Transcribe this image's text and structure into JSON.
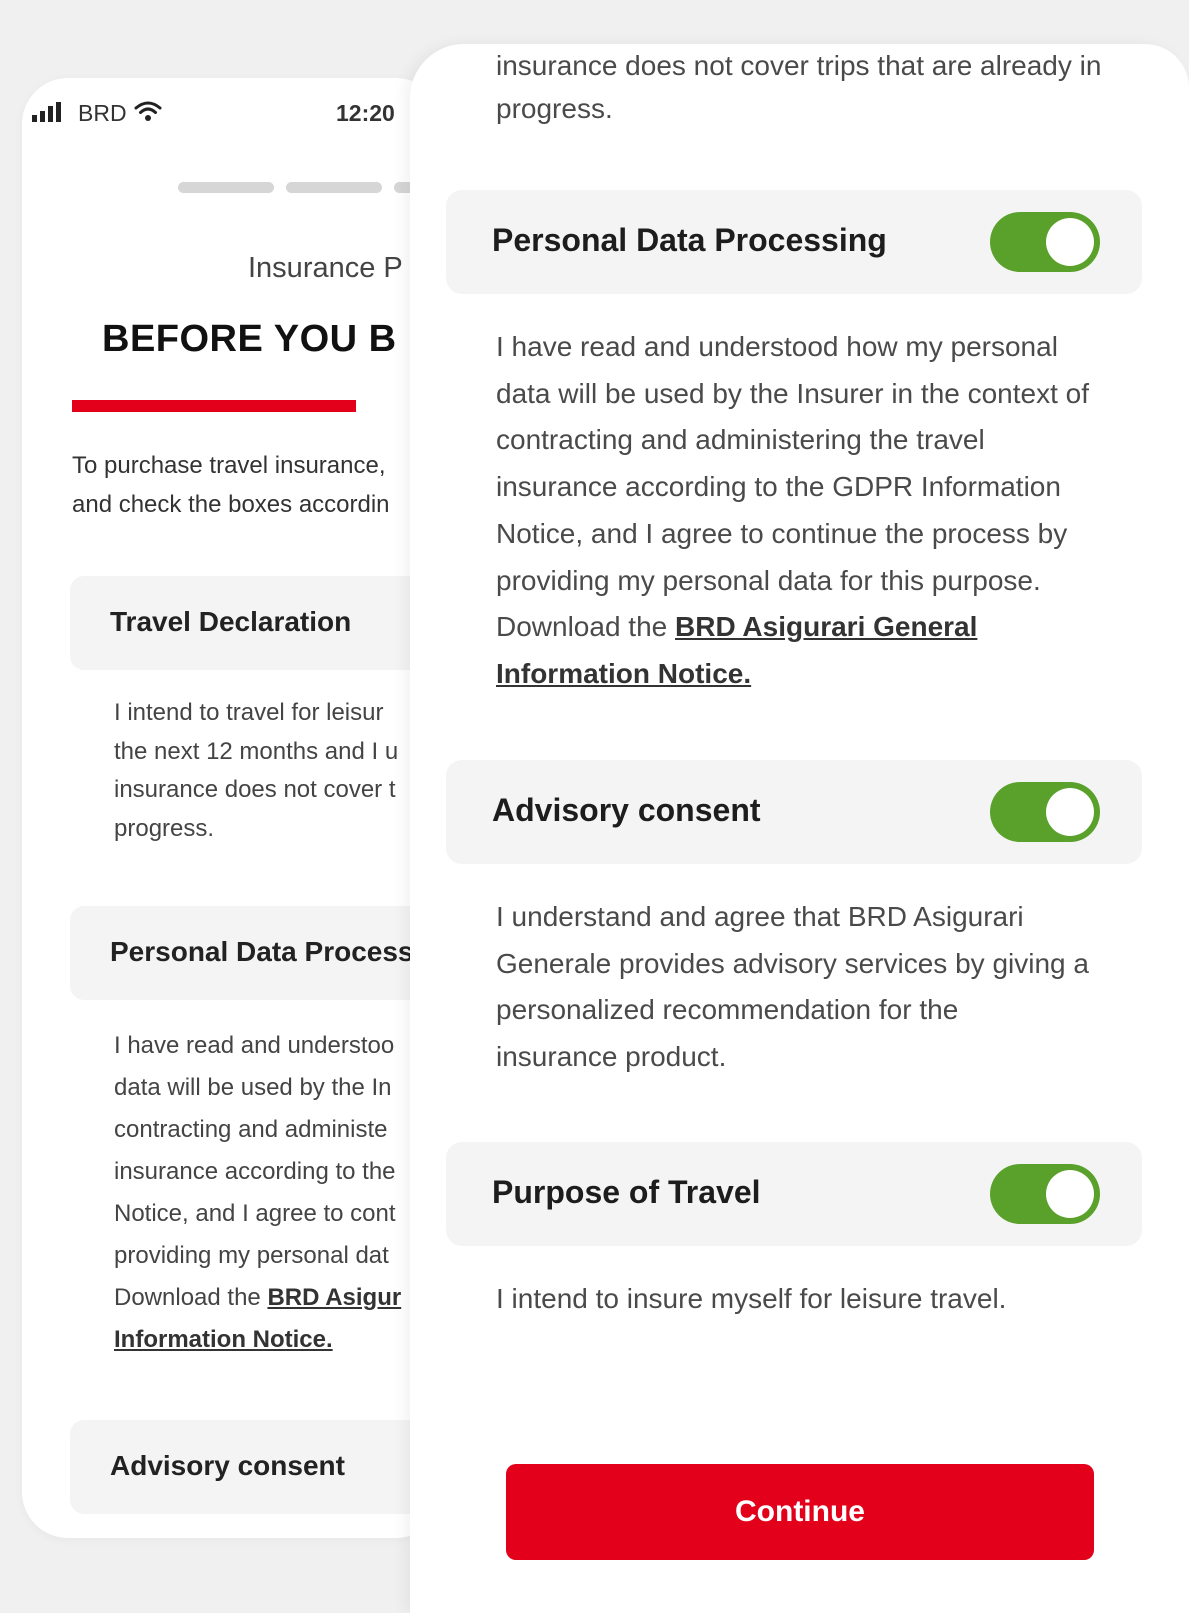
{
  "status_bar": {
    "carrier": "BRD",
    "time": "12:20",
    "icons": [
      "signal-icon",
      "wifi-icon"
    ]
  },
  "back_screen": {
    "kicker": "Insurance P",
    "title": "BEFORE YOU B",
    "intro_lines": [
      "To purchase travel insurance,",
      "and check the boxes accordin"
    ],
    "cards": [
      {
        "title": "Travel Declaration"
      },
      {
        "title": "Personal Data Processi"
      },
      {
        "title": "Advisory consent"
      }
    ],
    "travel_text_lines": [
      "I intend to travel for leisur",
      "the next 12 months and I u",
      "insurance does not cover t",
      "progress."
    ],
    "pdp_text_lines": [
      "I have read and understoo",
      "data will be used by the In",
      "contracting and administe",
      "insurance according to the",
      "Notice, and I agree to cont",
      "providing my personal dat"
    ],
    "pdp_download_prefix": "Download the ",
    "pdp_link_line1": "BRD Asigur",
    "pdp_link_line2": "Information Notice."
  },
  "front_panel": {
    "top_text_lines": [
      "insurance does not cover trips that are already in",
      "progress."
    ],
    "sections": [
      {
        "title": "Personal Data Processing",
        "toggle_on": true,
        "text_lines": [
          "I have read and understood how my personal",
          "data will be used by the Insurer in the context of",
          "contracting and administering the travel",
          "insurance according to the GDPR Information",
          "Notice, and I agree to continue the process by",
          "providing my personal data for this purpose."
        ],
        "download_prefix": "Download the ",
        "link_line1": "BRD Asigurari General",
        "link_line2": "Information Notice."
      },
      {
        "title": "Advisory consent",
        "toggle_on": true,
        "text_lines": [
          "I understand and agree that BRD Asigurari",
          "Generale provides advisory services by giving a",
          "personalized recommendation for the",
          "insurance product."
        ]
      },
      {
        "title": "Purpose of Travel",
        "toggle_on": true,
        "text_lines": [
          "I intend to insure myself for leisure travel."
        ]
      }
    ],
    "continue_label": "Continue"
  },
  "colors": {
    "accent_red": "#e2001a",
    "toggle_green": "#5aa12c",
    "card_gray": "#f4f4f4"
  }
}
